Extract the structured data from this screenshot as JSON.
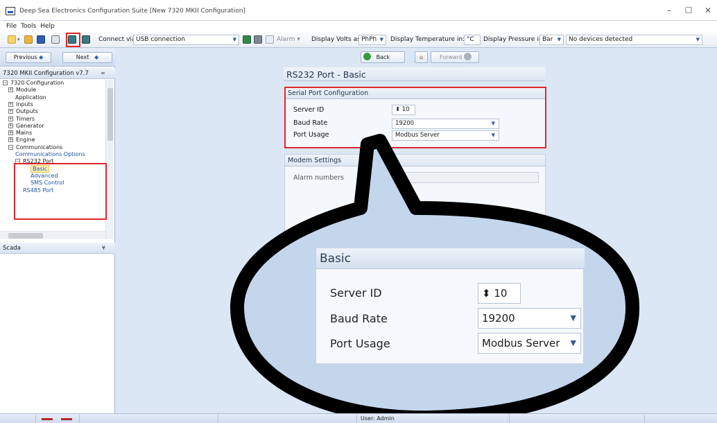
{
  "window": {
    "title": "Deep Sea Electronics Configuration Suite [New 7320 MKII Configuration]",
    "minimize": "–",
    "maximize": "☐",
    "close": "✕"
  },
  "menu": [
    "File",
    "Tools",
    "Help"
  ],
  "toolbar": {
    "connect_via_label": "Connect via",
    "connect_via_value": "USB connection",
    "alarm_label": "Alarm",
    "display_volts_label": "Display Volts as:",
    "display_volts_value": "PhPh",
    "display_temp_label": "Display Temperature in:",
    "display_temp_value": "°C",
    "display_pressure_label": "Display Pressure in:",
    "display_pressure_value": "Bar",
    "device_status": "No devices detected"
  },
  "nav": {
    "previous": "Previous",
    "next": "Next",
    "back": "Back",
    "forward": "Forward"
  },
  "tree_header": "7320 MKII Configuration v7.7",
  "tree": [
    {
      "label": "7320 Configuration",
      "sign": "−"
    },
    {
      "label": "Module",
      "sign": "+"
    },
    {
      "label": "Application",
      "sign": ""
    },
    {
      "label": "Inputs",
      "sign": "+"
    },
    {
      "label": "Outputs",
      "sign": "+"
    },
    {
      "label": "Timers",
      "sign": "+"
    },
    {
      "label": "Generator",
      "sign": "+"
    },
    {
      "label": "Mains",
      "sign": "+"
    },
    {
      "label": "Engine",
      "sign": "+"
    },
    {
      "label": "Communications",
      "sign": "−"
    },
    {
      "label": "Communications Options",
      "sign": ""
    },
    {
      "label": "RS232 Port",
      "sign": "−"
    },
    {
      "label": "Basic",
      "sign": ""
    },
    {
      "label": "Advanced",
      "sign": ""
    },
    {
      "label": "SMS Control",
      "sign": ""
    },
    {
      "label": "RS485 Port",
      "sign": ""
    }
  ],
  "scada_header": "Scada",
  "page_title": "RS232 Port - Basic",
  "serial": {
    "title": "Serial Port Configuration",
    "server_id_label": "Server ID",
    "server_id_value": "10",
    "baud_label": "Baud Rate",
    "baud_value": "19200",
    "usage_label": "Port Usage",
    "usage_value": "Modbus Server"
  },
  "modem": {
    "title": "Modem Settings",
    "alarm_numbers_label": "Alarm numbers"
  },
  "zoom": {
    "title": "Basic",
    "server_id_label": "Server ID",
    "server_id_value": "10",
    "baud_label": "Baud Rate",
    "baud_value": "19200",
    "usage_label": "Port Usage",
    "usage_value": "Modbus Server"
  },
  "status": {
    "user": "User: Admin"
  },
  "colors": {
    "highlight_box": "#e0262a",
    "panel_bg": "#dce7f5"
  }
}
